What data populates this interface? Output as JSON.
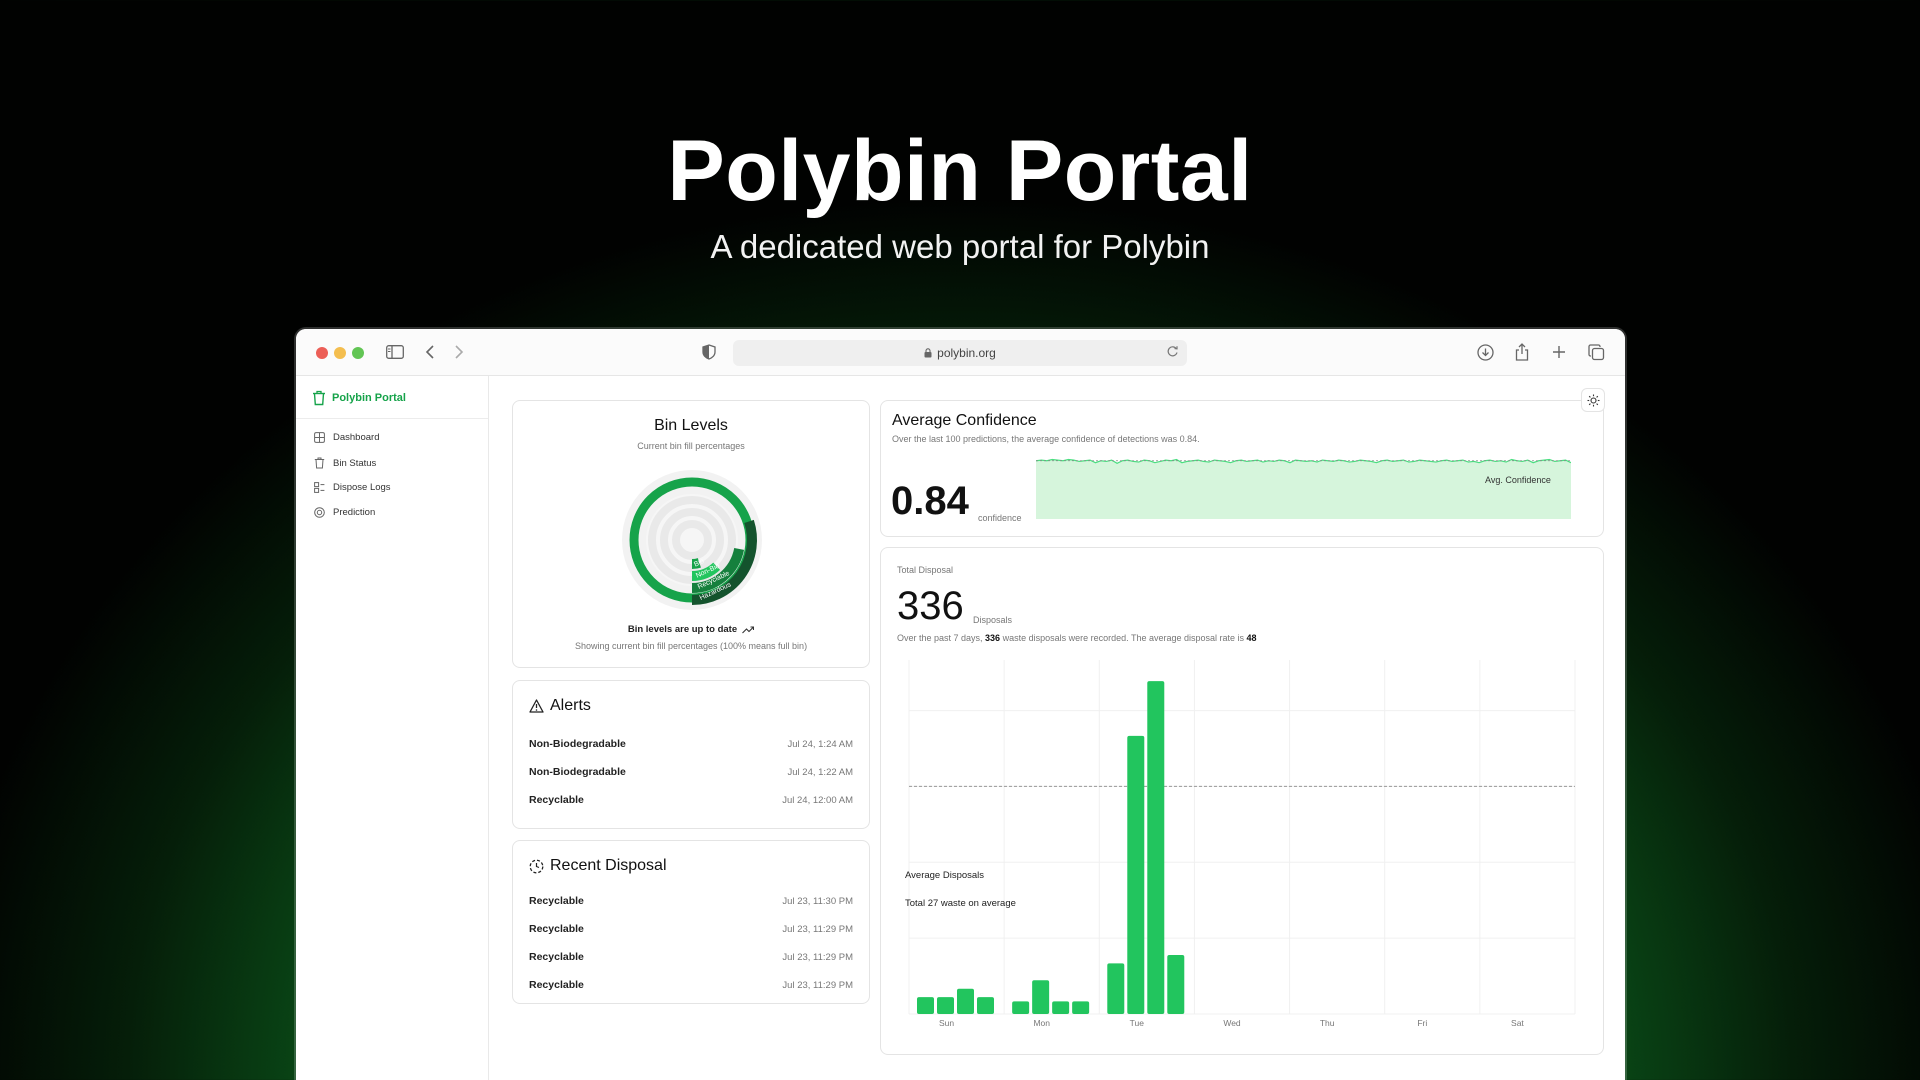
{
  "hero": {
    "title": "Polybin Portal",
    "subtitle": "A dedicated web portal for Polybin"
  },
  "browser": {
    "url": "polybin.org"
  },
  "sidebar": {
    "brand": "Polybin Portal",
    "items": [
      {
        "label": "Dashboard",
        "icon": "grid-icon"
      },
      {
        "label": "Bin Status",
        "icon": "trash-icon"
      },
      {
        "label": "Dispose Logs",
        "icon": "logs-icon"
      },
      {
        "label": "Prediction",
        "icon": "target-icon"
      }
    ]
  },
  "bin_levels": {
    "title": "Bin Levels",
    "subtitle": "Current bin fill percentages",
    "status": "Bin levels are up to date",
    "note": "Showing current bin fill percentages (100% means full bin)",
    "bins": [
      {
        "label": "Bio",
        "fill": 0.05
      },
      {
        "label": "Non-Bio",
        "fill": 0.12
      },
      {
        "label": "Recyclable",
        "fill": 0.22
      },
      {
        "label": "Hazardous",
        "fill": 0.3
      }
    ]
  },
  "alerts": {
    "title": "Alerts",
    "items": [
      {
        "name": "Non-Biodegradable",
        "time": "Jul 24, 1:24 AM"
      },
      {
        "name": "Non-Biodegradable",
        "time": "Jul 24, 1:22 AM"
      },
      {
        "name": "Recyclable",
        "time": "Jul 24, 12:00 AM"
      }
    ]
  },
  "recent": {
    "title": "Recent Disposal",
    "items": [
      {
        "name": "Recyclable",
        "time": "Jul 23, 11:30 PM"
      },
      {
        "name": "Recyclable",
        "time": "Jul 23, 11:29 PM"
      },
      {
        "name": "Recyclable",
        "time": "Jul 23, 11:29 PM"
      },
      {
        "name": "Recyclable",
        "time": "Jul 23, 11:29 PM"
      }
    ]
  },
  "confidence": {
    "title": "Average Confidence",
    "description": "Over the last 100 predictions, the average confidence of detections was 0.84.",
    "value": "0.84",
    "unit": "confidence",
    "legend": "Avg. Confidence"
  },
  "disposal": {
    "label": "Total Disposal",
    "value": "336",
    "unit": "Disposals",
    "summary_prefix": "Over the past 7 days, ",
    "summary_count": "336",
    "summary_mid": " waste disposals were recorded. The average disposal rate is ",
    "summary_rate": "48",
    "avg_label": "Average Disposals",
    "avg_sub": "Total 27 waste on average"
  },
  "colors": {
    "accent": "#16a34a",
    "bar": "#22c55e",
    "area": "#d6f5dc",
    "area_line": "#4ade80"
  },
  "chart_data": [
    {
      "type": "bar",
      "categories": [
        "Sun",
        "Mon",
        "Tue",
        "Wed",
        "Thu",
        "Fri",
        "Sat"
      ],
      "series": [
        {
          "values": [
            [
              2,
              2,
              3,
              2
            ],
            [
              1.5,
              4,
              1.5,
              1.5
            ],
            [
              6,
              33,
              39.5,
              7
            ],
            [],
            [],
            [],
            []
          ]
        }
      ],
      "ylim": [
        0,
        42
      ],
      "reference_line": 27,
      "grid": true
    },
    {
      "type": "area",
      "series": [
        {
          "name": "Avg. Confidence",
          "values": [
            0.91,
            0.92,
            0.91,
            0.93,
            0.92,
            0.91,
            0.93,
            0.92,
            0.9,
            0.91,
            0.92,
            0.88,
            0.91,
            0.9,
            0.92,
            0.87,
            0.91,
            0.92,
            0.9,
            0.89,
            0.92,
            0.91,
            0.88,
            0.9,
            0.92,
            0.91,
            0.93,
            0.88,
            0.9,
            0.91,
            0.92,
            0.9,
            0.89,
            0.92,
            0.91,
            0.9,
            0.88,
            0.91,
            0.92,
            0.9,
            0.91,
            0.92,
            0.89,
            0.91,
            0.9,
            0.92,
            0.91,
            0.88,
            0.92,
            0.91,
            0.9,
            0.91,
            0.89,
            0.92,
            0.91,
            0.9,
            0.92,
            0.91,
            0.89,
            0.9,
            0.92,
            0.91,
            0.9,
            0.88,
            0.91,
            0.92,
            0.9,
            0.91,
            0.92,
            0.89,
            0.9,
            0.92,
            0.91,
            0.9,
            0.89,
            0.91,
            0.92,
            0.9,
            0.91,
            0.92,
            0.89,
            0.9,
            0.88,
            0.91,
            0.92,
            0.9,
            0.91,
            0.89,
            0.93,
            0.91,
            0.9,
            0.92,
            0.88,
            0.91,
            0.92,
            0.93,
            0.9,
            0.91,
            0.92,
            0.88
          ]
        }
      ],
      "ylim": [
        0,
        1
      ]
    }
  ]
}
